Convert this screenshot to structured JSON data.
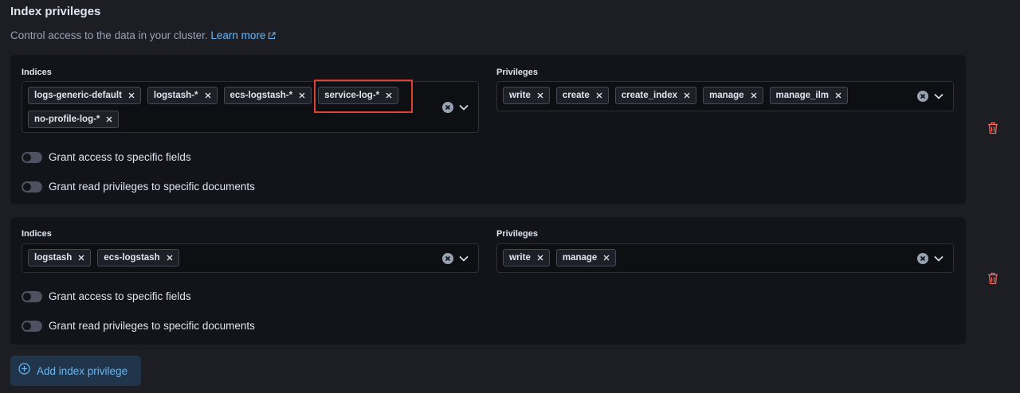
{
  "section": {
    "title": "Index privileges",
    "description": "Control access to the data in your cluster.",
    "learn_more": "Learn more"
  },
  "privilege_groups": [
    {
      "indices_label": "Indices",
      "indices": [
        "logs-generic-default",
        "logstash-*",
        "ecs-logstash-*",
        "service-log-*",
        "no-profile-log-*"
      ],
      "privileges_label": "Privileges",
      "privileges": [
        "write",
        "create",
        "create_index",
        "manage",
        "manage_ilm"
      ],
      "grant_fields_label": "Grant access to specific fields",
      "grant_fields_enabled": false,
      "grant_docs_label": "Grant read privileges to specific documents",
      "grant_docs_enabled": false
    },
    {
      "indices_label": "Indices",
      "indices": [
        "logstash",
        "ecs-logstash"
      ],
      "privileges_label": "Privileges",
      "privileges": [
        "write",
        "manage"
      ],
      "grant_fields_label": "Grant access to specific fields",
      "grant_fields_enabled": false,
      "grant_docs_label": "Grant read privileges to specific documents",
      "grant_docs_enabled": false
    }
  ],
  "add_button": {
    "label": "Add index privilege"
  },
  "icons": {
    "pill_remove": "cross-icon",
    "clear": "clear-icon",
    "dropdown": "chevron-down-icon",
    "delete": "trash-icon",
    "add": "plus-circle-icon",
    "external": "external-link-icon"
  },
  "colors": {
    "background": "#1d1e24",
    "panel": "#131419",
    "link": "#6bb7f5",
    "danger": "#f06a5f",
    "highlight": "#e0402f"
  }
}
